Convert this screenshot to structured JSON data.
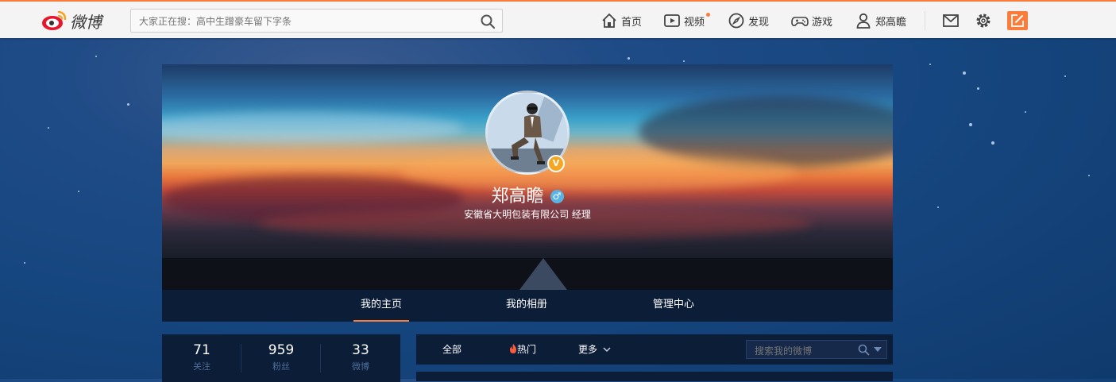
{
  "topbar": {
    "logo_text": "微博",
    "search_placeholder": "大家正在搜：高中生蹭豪车留下字条",
    "nav": [
      {
        "label": "首页",
        "icon": "home-icon"
      },
      {
        "label": "视频",
        "icon": "video-icon"
      },
      {
        "label": "发现",
        "icon": "compass-icon"
      },
      {
        "label": "游戏",
        "icon": "gamepad-icon"
      },
      {
        "label": "郑高瞻",
        "icon": "user-icon"
      }
    ],
    "icons": [
      "mail-icon",
      "gear-icon",
      "compose-icon"
    ],
    "accent": "#fa7d3c"
  },
  "profile": {
    "name": "郑高瞻",
    "gender_symbol": "♂",
    "verified_mark": "V",
    "intro": "安徽省大明包装有限公司 经理"
  },
  "tabs": [
    "我的主页",
    "我的相册",
    "管理中心"
  ],
  "stats": [
    {
      "num": "71",
      "label": "关注"
    },
    {
      "num": "959",
      "label": "粉丝"
    },
    {
      "num": "33",
      "label": "微博"
    }
  ],
  "feed": {
    "tabs": {
      "all": "全部",
      "hot": "热门",
      "more": "更多"
    },
    "search_placeholder": "搜索我的微博"
  }
}
